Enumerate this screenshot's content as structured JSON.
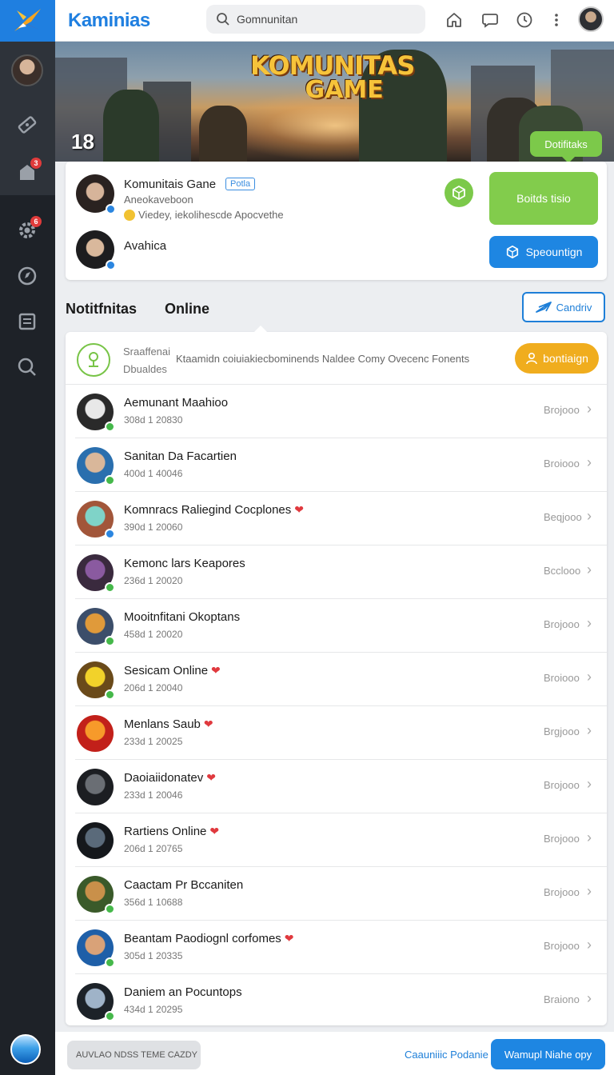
{
  "app": {
    "brand": "Kaminias"
  },
  "search": {
    "value": "Gomnunitan"
  },
  "sidebar": {
    "badges": [
      "3",
      "6"
    ]
  },
  "banner": {
    "title_line1": "KOMUNITAS",
    "title_line2": "GAME",
    "count": "18",
    "pill_label": "Dotifitaks"
  },
  "community": {
    "name": "Komunitais Gane",
    "tag": "Potla",
    "sub1": "Aneokaveboon",
    "sub2": "Viedey, iekolihescde Apocvethe",
    "second_name": "Avahica",
    "green_button": "Boitds tisio",
    "blue_button": "Speountign"
  },
  "section": {
    "title1": "Notitfnitas",
    "title2": "Online",
    "outline_button": "Candriv"
  },
  "filter": {
    "label1": "Sraaffenai",
    "label2": "Dbualdes",
    "text": "Ktaamidn coiuiakiecbominends Naldee Comy Ovecenc Fonents",
    "button": "bontiaign"
  },
  "rows": [
    {
      "name": "Aemunant Maahioo",
      "meta": "308d 1 20830",
      "status": "Brojooo",
      "heart": false,
      "verify": "green",
      "color1": "#e8e8e8",
      "color2": "#2a2a2a"
    },
    {
      "name": "Sanitan Da Facartien",
      "meta": "400d 1 40046",
      "status": "Broiooo",
      "heart": false,
      "verify": "green",
      "color1": "#d9b79a",
      "color2": "#2a6fae"
    },
    {
      "name": "Komnracs Raliegind Cocplones",
      "meta": "390d 1 20060",
      "status": "Beqjooo",
      "heart": true,
      "verify": "blue",
      "color1": "#7fd3c8",
      "color2": "#a2563a"
    },
    {
      "name": "Kemonc lars Keapores",
      "meta": "236d 1 20020",
      "status": "Bcclooo",
      "heart": false,
      "verify": "green",
      "color1": "#8a5aa0",
      "color2": "#3a2a3e"
    },
    {
      "name": "Mooitnfitani Okoptans",
      "meta": "458d 1 20020",
      "status": "Brojooo",
      "heart": false,
      "verify": "green",
      "color1": "#e09a3a",
      "color2": "#3c4e6a"
    },
    {
      "name": "Sesicam Online",
      "meta": "206d 1 20040",
      "status": "Broiooo",
      "heart": true,
      "verify": "green",
      "color1": "#f2d22a",
      "color2": "#6a4a1a"
    },
    {
      "name": "Menlans Saub",
      "meta": "233d 1 20025",
      "status": "Brgjooo",
      "heart": true,
      "verify": "none",
      "color1": "#f79a2a",
      "color2": "#c2201a"
    },
    {
      "name": "Daoiaiidonatev",
      "meta": "233d 1 20046",
      "status": "Brojooo",
      "heart": true,
      "verify": "none",
      "color1": "#6a6e74",
      "color2": "#1c1e22"
    },
    {
      "name": "Rartiens Online",
      "meta": "206d 1 20765",
      "status": "Brojooo",
      "heart": true,
      "verify": "none",
      "color1": "#5a6a7a",
      "color2": "#15181c"
    },
    {
      "name": "Caactam Pr Bccaniten",
      "meta": "356d 1 10688",
      "status": "Brojooo",
      "heart": false,
      "verify": "green",
      "color1": "#c9904a",
      "color2": "#3a5a2a"
    },
    {
      "name": "Beantam Paodiognl corfomes",
      "meta": "305d 1 20335",
      "status": "Brojooo",
      "heart": true,
      "verify": "green",
      "color1": "#d9a278",
      "color2": "#1e5fa8"
    },
    {
      "name": "Daniem an Pocuntops",
      "meta": "434d 1 20295",
      "status": "Braiono",
      "heart": false,
      "verify": "green",
      "color1": "#9fb3c8",
      "color2": "#1c2228"
    }
  ],
  "footer": {
    "input_value": "AUVLAO NDSS TEME CAZDY",
    "link": "Caauniiic Podanie",
    "button": "Wamupl Niahe opy"
  },
  "colors": {
    "accent": "#1e86e2",
    "green": "#82cc4c",
    "orange": "#f0ad1e",
    "sidebar": "#1e2228"
  }
}
